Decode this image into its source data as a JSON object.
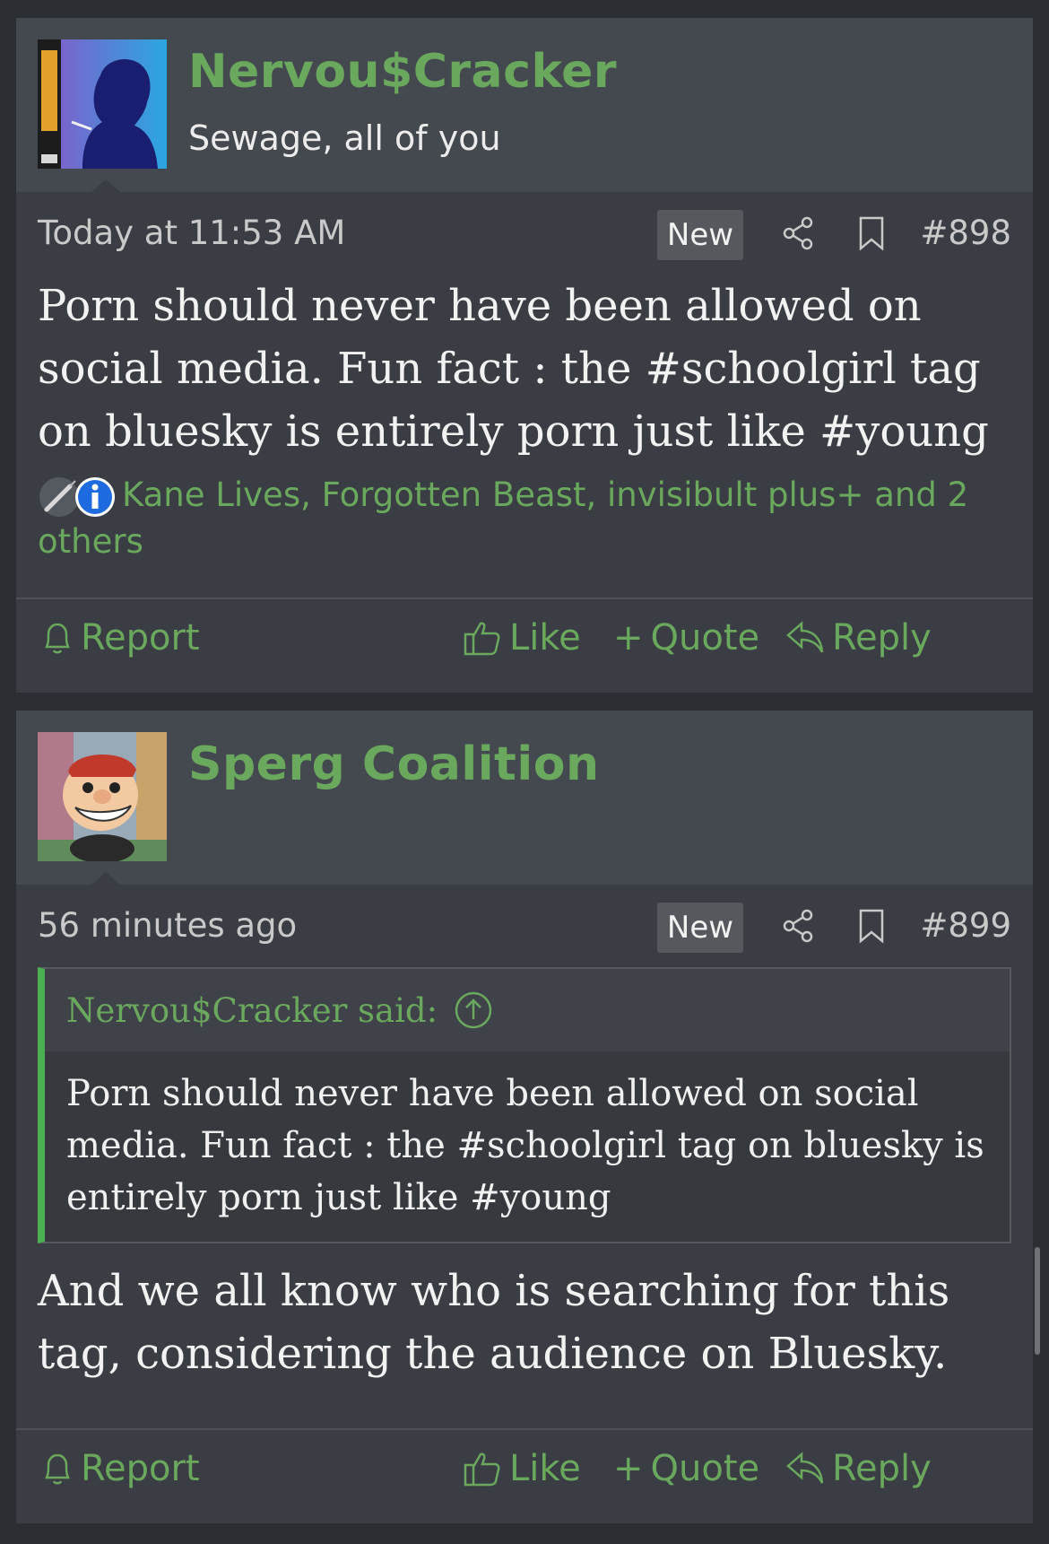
{
  "posts": [
    {
      "username": "Nervou$Cracker",
      "user_title": "Sewage, all of you",
      "timestamp": "Today at 11:53 AM",
      "badge": "New",
      "post_number": "#898",
      "body": "Porn should never have been allowed on social media. Fun fact : the #schoolgirl tag on bluesky is entirely porn just like #young",
      "reactions_text": "Kane Lives, Forgotten Beast, invisibult plus+ and 2 others",
      "actions": {
        "report": "Report",
        "like": "Like",
        "quote": "Quote",
        "reply": "Reply"
      }
    },
    {
      "username": "Sperg Coalition",
      "user_title": "",
      "timestamp": "56 minutes ago",
      "badge": "New",
      "post_number": "#899",
      "quote": {
        "attribution": "Nervou$Cracker said:",
        "text": "Porn should never have been allowed on social media. Fun fact : the #schoolgirl tag on bluesky is entirely porn just like #young"
      },
      "body": "And we all know who is searching for this tag, considering the audience on Bluesky.",
      "actions": {
        "report": "Report",
        "like": "Like",
        "quote": "Quote",
        "reply": "Reply"
      }
    }
  ],
  "colors": {
    "accent": "#6aa85d",
    "quote_bar": "#4caf50",
    "background": "#2b2f34",
    "post_bg": "#3a3d43"
  }
}
